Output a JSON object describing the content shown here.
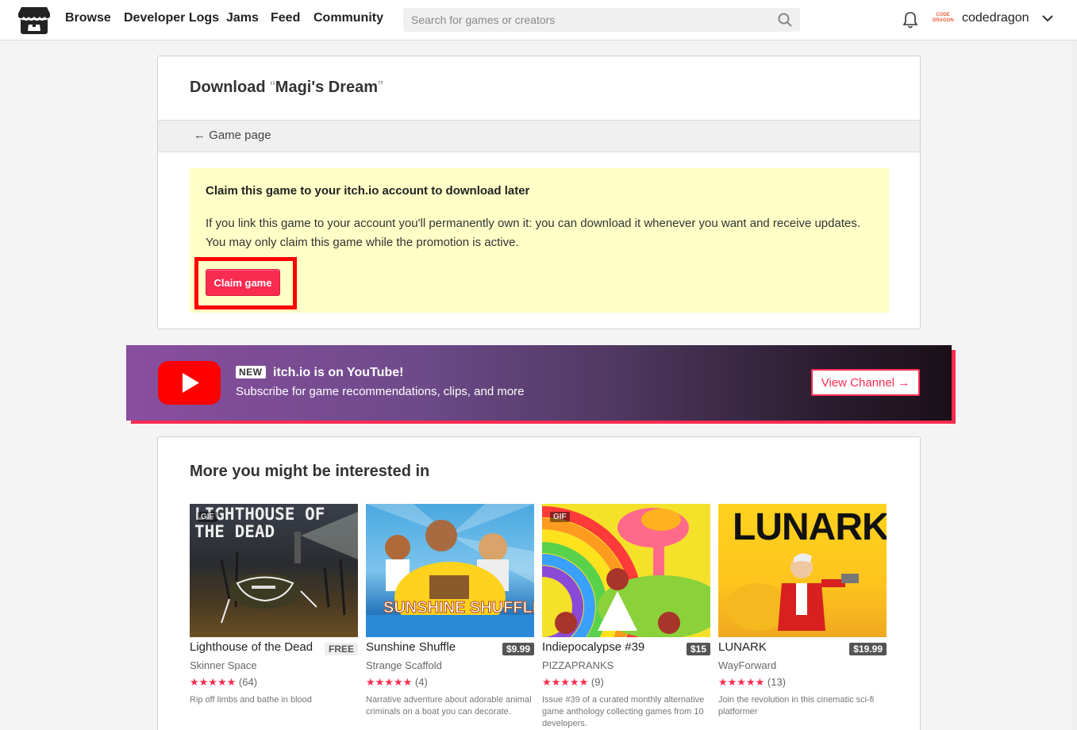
{
  "header": {
    "nav": [
      "Browse",
      "Developer Logs",
      "Jams",
      "Feed",
      "Community"
    ],
    "search_placeholder": "Search for games or creators",
    "avatar_text": "CODE DRAGON",
    "username": "codedragon"
  },
  "download": {
    "title_prefix": "Download",
    "quote_open": "“",
    "game_name": "Magi's Dream",
    "quote_close": "”",
    "back_link": "← Game page",
    "claim_title": "Claim this game to your itch.io account to download later",
    "claim_text": "If you link this game to your account you'll permanently own it: you can download it whenever you want and receive updates. You may only claim this game while the promotion is active.",
    "claim_button": "Claim game"
  },
  "youtube": {
    "badge": "NEW",
    "title": "itch.io is on YouTube!",
    "subtitle": "Subscribe for game recommendations, clips, and more",
    "button": "View Channel →"
  },
  "recommendations": {
    "title": "More you might be interested in",
    "items": [
      {
        "title": "Lighthouse of the Dead",
        "price": "FREE",
        "author": "Skinner Space",
        "stars": "★★★★★",
        "rating_count": "(64)",
        "desc": "Rip off limbs and bathe in blood",
        "gif": "GIF",
        "thumb_text": "LIGHTHOUSE OF THE DEAD"
      },
      {
        "title": "Sunshine Shuffle",
        "price": "$9.99",
        "author": "Strange Scaffold",
        "stars": "★★★★★",
        "rating_count": "(4)",
        "desc": "Narrative adventure about adorable animal criminals on a boat you can decorate.",
        "gif": "",
        "thumb_text": "SUNSHINE SHUFFLE"
      },
      {
        "title": "Indiepocalypse #39",
        "price": "$15",
        "author": "PIZZAPRANKS",
        "stars": "★★★★★",
        "rating_count": "(9)",
        "desc": "Issue #39 of a curated monthly alternative game anthology collecting games from 10 developers.",
        "gif": "GIF",
        "thumb_text": ""
      },
      {
        "title": "LUNARK",
        "price": "$19.99",
        "author": "WayForward",
        "stars": "★★★★★",
        "rating_count": "(13)",
        "desc": "Join the revolution in this cinematic sci-fi platformer",
        "gif": "",
        "thumb_text": "LUNARK"
      }
    ]
  },
  "colors": {
    "accent": "#fa2b50",
    "claim_bg": "#ffffc7",
    "highlight": "#ff0000"
  }
}
